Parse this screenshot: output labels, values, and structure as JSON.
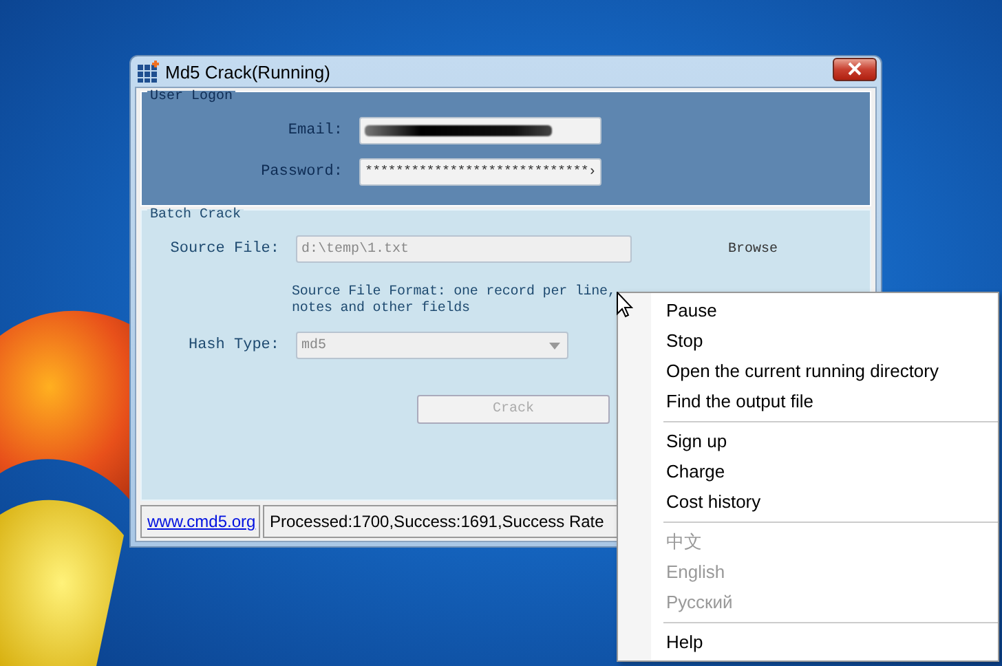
{
  "window": {
    "title": "Md5 Crack(Running)"
  },
  "user_logon": {
    "title": "User Logon",
    "email": {
      "label": "Email:",
      "redacted": true
    },
    "password": {
      "label": "Password:",
      "value": "*****************************›"
    }
  },
  "batch_crack": {
    "title": "Batch Crack",
    "source_file": {
      "label": "Source File:",
      "value": "d:\\temp\\1.txt",
      "disabled": true
    },
    "browse": "Browse",
    "format_note": "Source File Format: one record per line, notes and other fields",
    "hash_type": {
      "label": "Hash Type:",
      "value": "md5",
      "disabled": true
    },
    "crack_button": {
      "label": "Crack",
      "disabled": true
    }
  },
  "status_bar": {
    "link": "www.cmd5.org",
    "status": "Processed:1700,Success:1691,Success Rate"
  },
  "context_menu": {
    "groups": [
      [
        {
          "label": "Pause",
          "disabled": false
        },
        {
          "label": "Stop",
          "disabled": false
        },
        {
          "label": "Open the current running directory",
          "disabled": false
        },
        {
          "label": "Find the output file",
          "disabled": false
        }
      ],
      [
        {
          "label": "Sign up",
          "disabled": false
        },
        {
          "label": "Charge",
          "disabled": false
        },
        {
          "label": "Cost history",
          "disabled": false
        }
      ],
      [
        {
          "label": "中文",
          "disabled": true
        },
        {
          "label": "English",
          "disabled": true
        },
        {
          "label": "Русский",
          "disabled": true
        }
      ],
      [
        {
          "label": "Help",
          "disabled": false
        }
      ]
    ]
  }
}
